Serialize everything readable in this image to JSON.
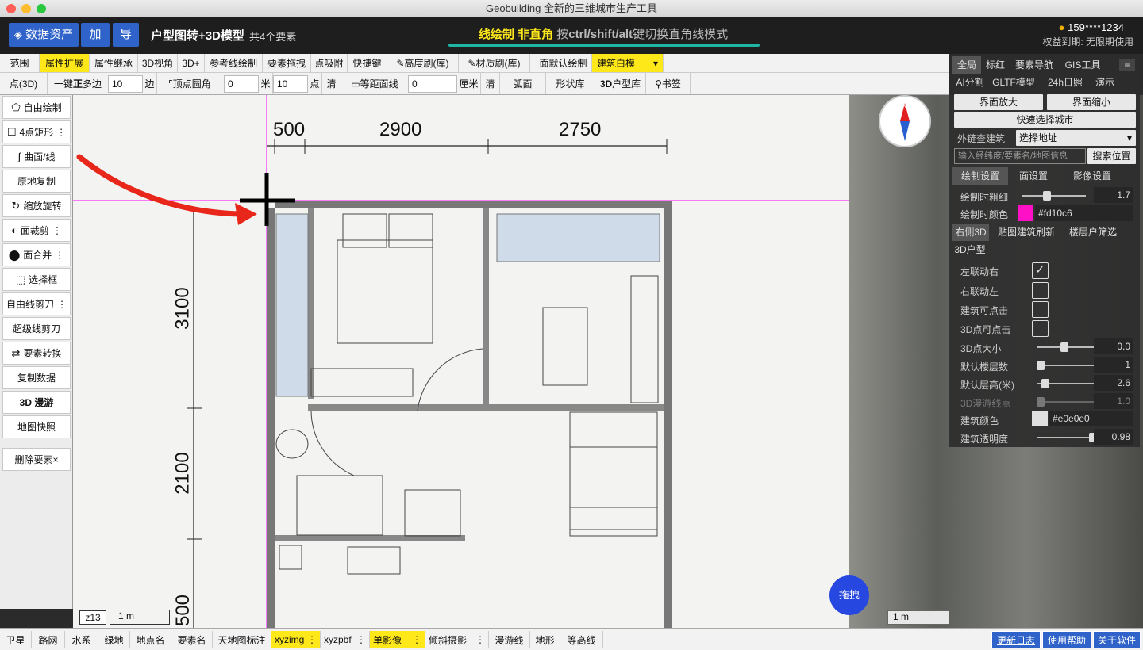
{
  "window": {
    "title": "Geobuilding 全新的三维城市生产工具"
  },
  "appbar": {
    "assets_label": "数据资产",
    "add_label": "加",
    "export_label": "导",
    "project_title": "户型图转+3D模型",
    "element_count": "共4个要素",
    "mode_main": "线绘制 非直角",
    "mode_hint_prefix": "按",
    "mode_hint_keys": "ctrl/shift/alt",
    "mode_hint_suffix": "键切换直角线模式",
    "user": "159****1234",
    "rights": "权益到期: 无限期使用"
  },
  "toolrow1": [
    "范围",
    "属性扩展",
    "属性继承",
    "3D视角",
    "3D+",
    "参考线绘制",
    "要素拖拽",
    "点吸附",
    "快捷键",
    "高度刷(库)",
    "材质刷(库)",
    "面默认绘制",
    "建筑白模"
  ],
  "toolrow2": {
    "point3d": "点(3D)",
    "poly_label_a": "一键",
    "poly_label_b": "正",
    "poly_label_c": "多边",
    "poly_value": "10",
    "poly_unit": "边",
    "corner_label": "顶点圆角",
    "corner_value": "0",
    "corner_unit": "米",
    "corner_pts": "10",
    "corner_pts_unit": "点",
    "clear1": "清",
    "equidist_label": "等距面线",
    "equidist_value": "0",
    "equidist_unit": "厘米",
    "clear2": "清",
    "arc": "弧面",
    "shapes": "形状库",
    "lib3d_a": "3D",
    "lib3d_b": "户型库",
    "bookmark": "书签"
  },
  "leftbar": [
    "自由绘制",
    "4点矩形",
    "曲面/线",
    "原地复制",
    "缩放旋转",
    "面裁剪",
    "面合并",
    "选择框",
    "自由线剪刀",
    "超级线剪刀",
    "要素转换",
    "复制数据",
    "3D 漫游",
    "地图快照",
    "删除要素×"
  ],
  "map": {
    "dims_top": [
      "500",
      "2900",
      "2750"
    ],
    "dims_left": [
      "3100",
      "2100",
      "500"
    ],
    "zoom": "z13",
    "scale_left": "1 m",
    "scale_right": "1 m",
    "drag_label": "拖拽",
    "compass_n": "N"
  },
  "rightpanel": {
    "tabs_row1": [
      "全局",
      "标红",
      "要素导航",
      "GIS工具",
      "≡"
    ],
    "tabs_row2": [
      "AI分割",
      "GLTF模型",
      "24h日照",
      "演示"
    ],
    "zoom_in": "界面放大",
    "zoom_out": "界面缩小",
    "city_select": "快速选择城市",
    "outer_link": "外链查建筑",
    "address_select": "选择地址",
    "search_placeholder": "输入经纬度/要素名/地图信息",
    "search_btn": "搜索位置",
    "settings_tabs": [
      "绘制设置",
      "面设置",
      "影像设置"
    ],
    "line_width_label": "绘制时粗细",
    "line_width": "1.7",
    "line_color_label": "绘制时颜色",
    "line_color": "#fd10c6",
    "tabs_3d": [
      "右侧3D",
      "贴图建筑刷新",
      "楼层户筛选"
    ],
    "tab_3d_house": "3D户型",
    "link_right_label": "左联动右",
    "link_right": true,
    "link_left_label": "右联动左",
    "link_left": false,
    "building_click_label": "建筑可点击",
    "building_click": false,
    "point_click_label": "3D点可点击",
    "point_click": false,
    "point_size_label": "3D点大小",
    "point_size": "0.0",
    "floors_label": "默认楼层数",
    "floors": "1",
    "floor_height_label": "默认层高(米)",
    "floor_height": "2.6",
    "roam_label": "3D漫游线点",
    "roam": "1.0",
    "building_color_label": "建筑颜色",
    "building_color": "#e0e0e0",
    "opacity_label": "建筑透明度",
    "opacity": "0.98"
  },
  "bottombar": [
    "卫星",
    "路网",
    "水系",
    "绿地",
    "地点名",
    "要素名",
    "天地图标注",
    "xyzimg",
    "xyzpbf",
    "单影像",
    "倾斜摄影",
    "漫游线",
    "地形",
    "等高线"
  ],
  "bottom_right": [
    "更新日志",
    "使用帮助",
    "关于软件"
  ],
  "colors": {
    "accent": "#2f63c9",
    "highlight": "#ffe81a",
    "guide": "#ff00ff",
    "mode_bar": "#1fb5a5",
    "arrow": "#e8271a"
  }
}
